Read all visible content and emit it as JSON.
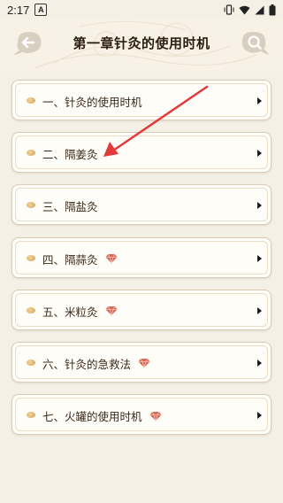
{
  "status": {
    "time": "2:17",
    "app_badge": "A"
  },
  "header": {
    "title": "第一章针灸的使用时机"
  },
  "items": [
    {
      "label": "一、针灸的使用时机",
      "locked": false
    },
    {
      "label": "二、隔姜灸",
      "locked": false
    },
    {
      "label": "三、隔盐灸",
      "locked": false
    },
    {
      "label": "四、隔蒜灸",
      "locked": true
    },
    {
      "label": "五、米粒灸",
      "locked": true
    },
    {
      "label": "六、针灸的急救法",
      "locked": true
    },
    {
      "label": "七、火罐的使用时机",
      "locked": true
    }
  ],
  "colors": {
    "accent": "#d96a5a",
    "annotation": "#e23a3a"
  }
}
